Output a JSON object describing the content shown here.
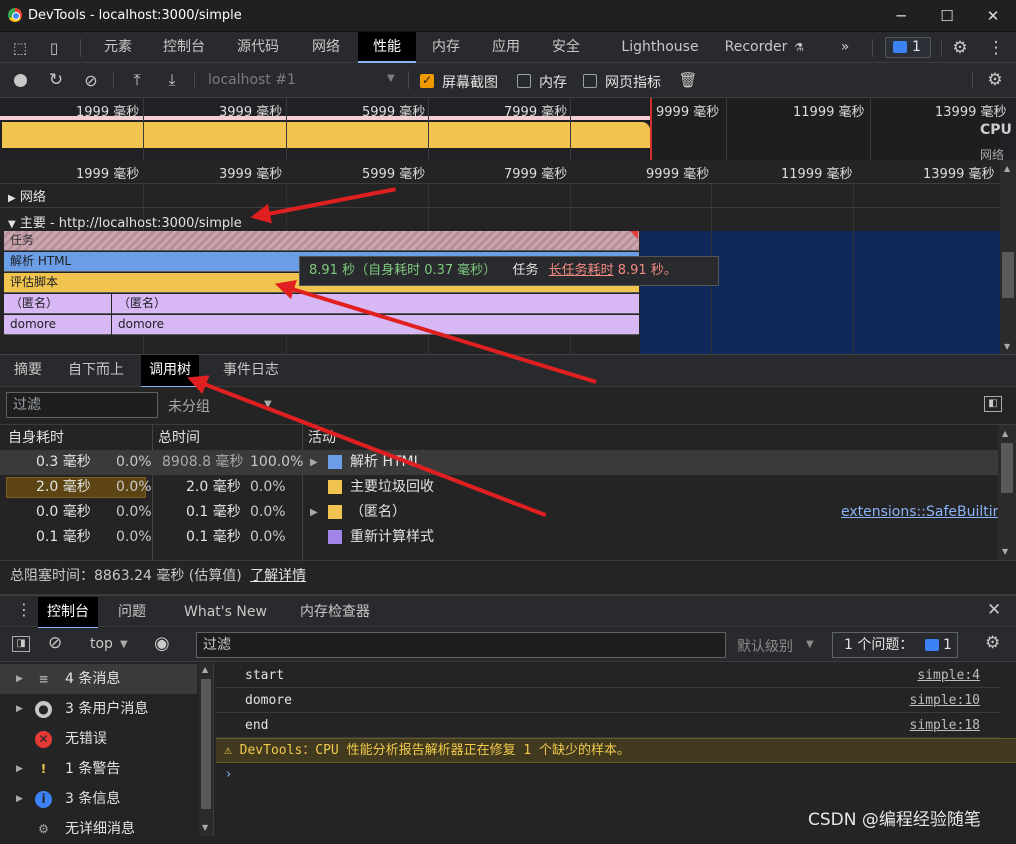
{
  "window": {
    "title": "DevTools - localhost:3000/simple",
    "min": "─",
    "max": "☐",
    "close": "✕"
  },
  "tabs": [
    "元素",
    "控制台",
    "源代码",
    "网络",
    "性能",
    "内存",
    "应用",
    "安全",
    "Lighthouse",
    "Recorder"
  ],
  "tabs_more": "»",
  "issues_badge": "1",
  "perf_toolbar": {
    "profile": "localhost #1",
    "screenshots": "屏幕截图",
    "memory": "内存",
    "web_vitals": "网页指标"
  },
  "overview": {
    "ticks": [
      "1999 毫秒",
      "3999 毫秒",
      "5999 毫秒",
      "7999 毫秒",
      "9999 毫秒",
      "11999 毫秒",
      "13999 毫秒"
    ],
    "cpu_label": "CPU",
    "net_label": "网络"
  },
  "flame": {
    "ticks": [
      "1999 毫秒",
      "3999 毫秒",
      "5999 毫秒",
      "7999 毫秒",
      "9999 毫秒",
      "11999 毫秒",
      "13999 毫秒"
    ],
    "network_track": "网络",
    "main_track": "主要 - http://localhost:3000/simple",
    "bars": {
      "task": "任务",
      "parse": "解析 HTML",
      "eval": "评估脚本",
      "anon1": "（匿名）",
      "anon2": "（匿名）",
      "domore1": "domore",
      "domore2": "domore"
    },
    "tooltip": {
      "time": "8.91 秒（自身耗时 0.37 毫秒）",
      "task": "任务",
      "warn": "长任务耗时",
      "warn_val": "8.91 秒。"
    }
  },
  "bottom_tabs": [
    "摘要",
    "自下而上",
    "调用树",
    "事件日志"
  ],
  "filter": {
    "placeholder": "过滤",
    "group": "未分组"
  },
  "tree": {
    "headers": [
      "自身耗时",
      "总时间",
      "活动"
    ],
    "rows": [
      {
        "self": "0.3 毫秒",
        "self_pct": "0.0%",
        "total": "8908.8 毫秒",
        "total_pct": "100.0%",
        "name": "解析 HTML",
        "color": "#6c9ee8",
        "expand": true,
        "link": ""
      },
      {
        "self": "2.0 毫秒",
        "self_pct": "0.0%",
        "total": "2.0 毫秒",
        "total_pct": "0.0%",
        "name": "主要垃圾回收",
        "color": "#f0c44e",
        "expand": false,
        "link": ""
      },
      {
        "self": "0.0 毫秒",
        "self_pct": "0.0%",
        "total": "0.1 毫秒",
        "total_pct": "0.0%",
        "name": "（匿名）",
        "color": "#f0c44e",
        "expand": true,
        "link": "extensions::SafeBuiltins"
      },
      {
        "self": "0.1 毫秒",
        "self_pct": "0.0%",
        "total": "0.1 毫秒",
        "total_pct": "0.0%",
        "name": "重新计算样式",
        "color": "#a285e8",
        "expand": false,
        "link": ""
      }
    ]
  },
  "blocking": {
    "text": "总阻塞时间：8863.24 毫秒 (估算值)",
    "link": "了解详情"
  },
  "console_tabs": [
    "控制台",
    "问题",
    "What's New",
    "内存检查器"
  ],
  "console_toolbar": {
    "context": "top",
    "filter": "过滤",
    "level": "默认级别",
    "issues": "1 个问题：",
    "issues_count": "1"
  },
  "sidebar": [
    {
      "label": "4 条消息",
      "icon": "≡"
    },
    {
      "label": "3 条用户消息",
      "icon": "●"
    },
    {
      "label": "无错误",
      "icon": "✕"
    },
    {
      "label": "1 条警告",
      "icon": "!"
    },
    {
      "label": "3 条信息",
      "icon": "i"
    },
    {
      "label": "无详细消息",
      "icon": "⚙"
    }
  ],
  "messages": [
    {
      "text": "start",
      "link": "simple:4"
    },
    {
      "text": "domore",
      "link": "simple:10"
    },
    {
      "text": "end",
      "link": "simple:18"
    }
  ],
  "warning": "DevTools：CPU 性能分析报告解析器正在修复 1 个缺少的样本。",
  "watermark": "CSDN @编程经验随笔"
}
